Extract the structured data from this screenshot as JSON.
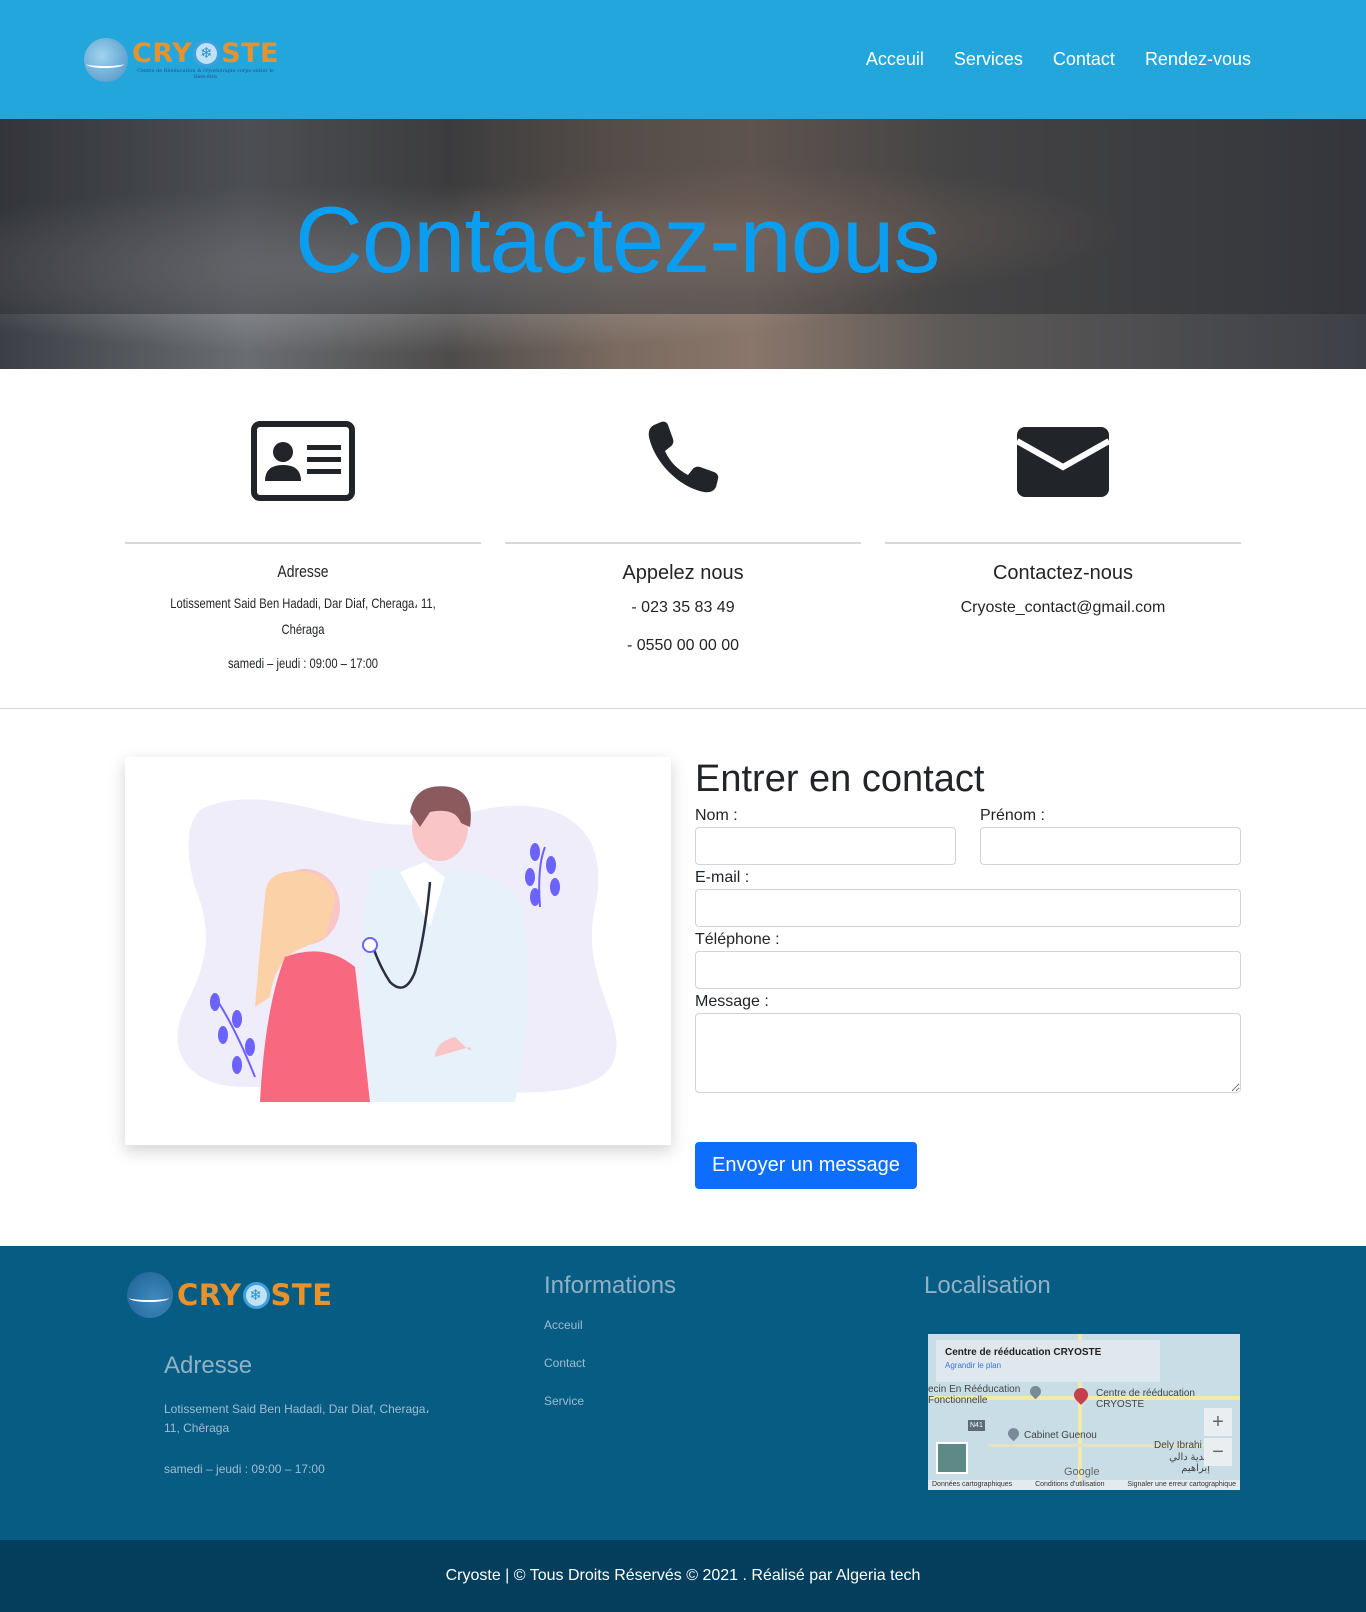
{
  "brand": {
    "name_before_o": "CRY",
    "name_after_o": "STE",
    "tagline": "Centre de Rééducation & cryothérapie corps entier le Bien-être",
    "colors": {
      "primary": "#22a6dc",
      "accent": "#e8922b",
      "footer": "#075c83",
      "button": "#0d6efd"
    }
  },
  "nav": {
    "links": [
      "Acceuil",
      "Services",
      "Contact",
      "Rendez-vous"
    ]
  },
  "hero": {
    "title": "Contactez-nous"
  },
  "info": [
    {
      "icon": "id-card-icon",
      "title": "Adresse",
      "lines": [
        "Lotissement Said Ben Hadadi, Dar Diaf, Cheraga، 11, Chéraga",
        "samedi – jeudi : 09:00 – 17:00"
      ]
    },
    {
      "icon": "phone-icon",
      "title": "Appelez nous",
      "lines": [
        "- 023 35 83 49",
        "- 0550 00 00 00"
      ]
    },
    {
      "icon": "envelope-icon",
      "title": "Contactez-nous",
      "lines": [
        "Cryoste_contact@gmail.com"
      ]
    }
  ],
  "form": {
    "title": "Entrer en contact",
    "labels": {
      "nom": "Nom :",
      "prenom": "Prénom :",
      "email": "E-mail :",
      "telephone": "Téléphone :",
      "message": "Message :"
    },
    "submit": "Envoyer un message"
  },
  "footer": {
    "informations_title": "Informations",
    "links": [
      "Acceuil",
      "Contact",
      "Service"
    ],
    "localisation_title": "Localisation",
    "address_title": "Adresse",
    "address": "Lotissement Said Ben Hadadi, Dar Diaf, Cheraga، 11, Chêraga",
    "hours": "samedi – jeudi : 09:00 – 17:00",
    "map": {
      "card_title": "Centre de rééducation CRYOSTE",
      "card_link": "Agrandir le plan",
      "label_1": "Centre de rééducation CRYOSTE",
      "label_2": "ecin En Rééducation Fonctionnelle",
      "label_3": "Cabinet Guenou",
      "label_4": "Dely Ibrahi",
      "label_5": "بلدية دالي إبراهيم",
      "road": "N41",
      "google": "Google",
      "footer_1": "Données cartographiques",
      "footer_2": "Conditions d'utilisation",
      "footer_3": "Signaler une erreur cartographique"
    }
  },
  "copyright": "Cryoste | © Tous Droits Réservés © 2021 . Réalisé par Algeria tech"
}
